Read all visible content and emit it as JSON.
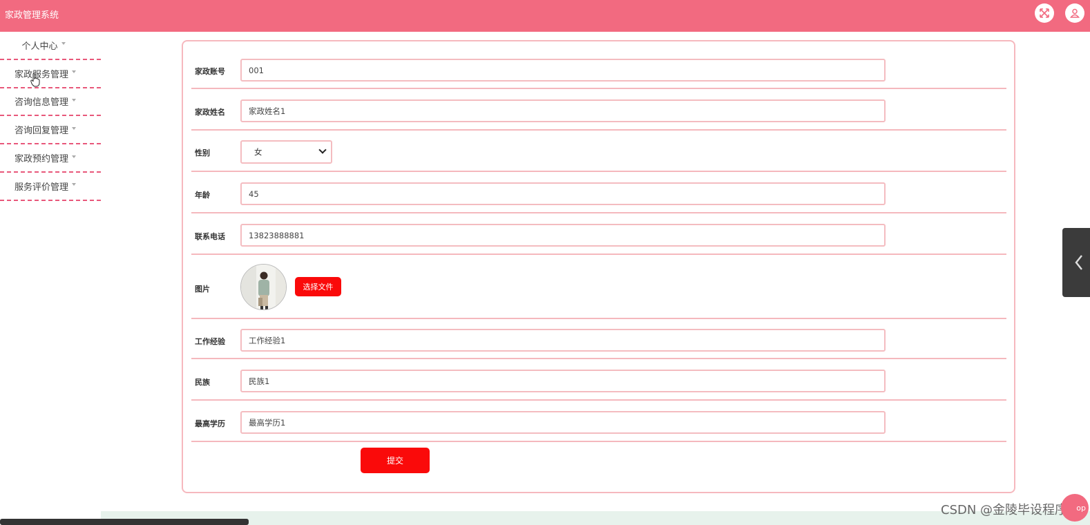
{
  "app": {
    "title": "家政管理系统"
  },
  "header": {
    "icons": [
      "fullscreen-icon",
      "user-icon"
    ]
  },
  "sidebar": {
    "items": [
      {
        "label": "个人中心"
      },
      {
        "label": "家政服务管理"
      },
      {
        "label": "咨询信息管理"
      },
      {
        "label": "咨询回复管理"
      },
      {
        "label": "家政预约管理"
      },
      {
        "label": "服务评价管理"
      }
    ]
  },
  "form": {
    "account": {
      "label": "家政账号",
      "value": "001"
    },
    "name": {
      "label": "家政姓名",
      "value": "家政姓名1"
    },
    "gender": {
      "label": "性别",
      "value": "女"
    },
    "age": {
      "label": "年龄",
      "value": "45"
    },
    "phone": {
      "label": "联系电话",
      "value": "13823888881"
    },
    "photo": {
      "label": "图片",
      "button": "选择文件"
    },
    "experience": {
      "label": "工作经验",
      "value": "工作经验1"
    },
    "ethnicity": {
      "label": "民族",
      "value": "民族1"
    },
    "education": {
      "label": "最高学历",
      "value": "最高学历1"
    },
    "submit": "提交"
  },
  "footer": {
    "watermark": "CSDN @金陵毕设程序",
    "top_badge": "op"
  },
  "colors": {
    "topbar": "#f26a80",
    "accent": "#fa0a0a",
    "border": "#f4bcc0",
    "menu_divider": "#e8577a"
  }
}
